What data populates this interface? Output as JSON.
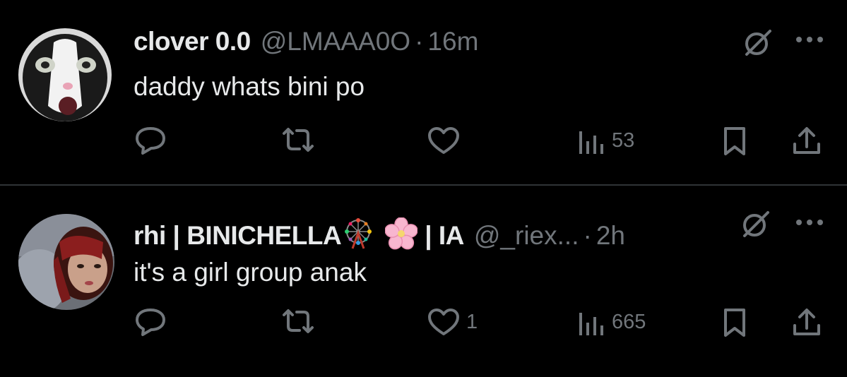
{
  "tweets": [
    {
      "display_name": "clover 0.0",
      "handle": "@LMAAA0O",
      "separator": "·",
      "time": "16m",
      "text": "daddy whats bini po",
      "reply_count": "",
      "retweet_count": "",
      "like_count": "",
      "view_count": "53",
      "avatar_icon": "cat-avatar"
    },
    {
      "display_name": "rhi | BINICHELLA",
      "name_suffix": "| IA",
      "emojis": [
        "ferris-wheel-emoji",
        "cherry-blossom-emoji"
      ],
      "handle": "@_riex...",
      "separator": "·",
      "time": "2h",
      "text": "it's a girl group anak",
      "reply_count": "",
      "retweet_count": "",
      "like_count": "1",
      "view_count": "665",
      "avatar_icon": "person-avatar"
    }
  ],
  "colors": {
    "background": "#000000",
    "primary_text": "#e7e9ea",
    "secondary_text": "#71767b",
    "divider": "#2f3336"
  },
  "icons": [
    "reply-icon",
    "retweet-icon",
    "like-icon",
    "views-icon",
    "bookmark-icon",
    "share-icon",
    "grok-icon",
    "more-icon"
  ]
}
